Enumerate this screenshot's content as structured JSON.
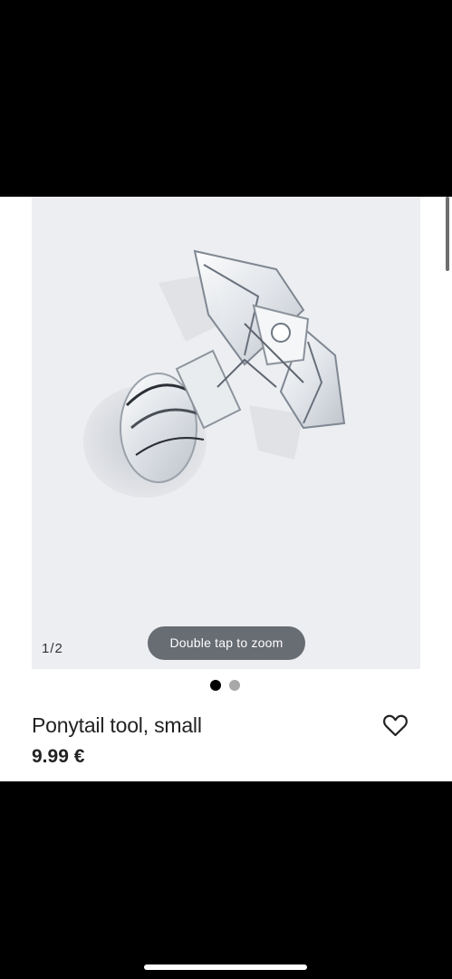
{
  "gallery": {
    "counter": "1/2",
    "zoom_hint": "Double tap to zoom",
    "active_index": 1,
    "total": 2,
    "image_label": "clear-acrylic-ponytail-tool-image"
  },
  "product": {
    "title": "Ponytail tool, small",
    "price": "9.99 €",
    "wishlist_icon": "heart-outline-icon"
  },
  "colors": {
    "background": "#000000",
    "card": "#ffffff",
    "image_bg": "#eceef1",
    "pill": "#686c73",
    "dot_active": "#000000",
    "dot_inactive": "#a8a8a8",
    "text": "#222222"
  }
}
